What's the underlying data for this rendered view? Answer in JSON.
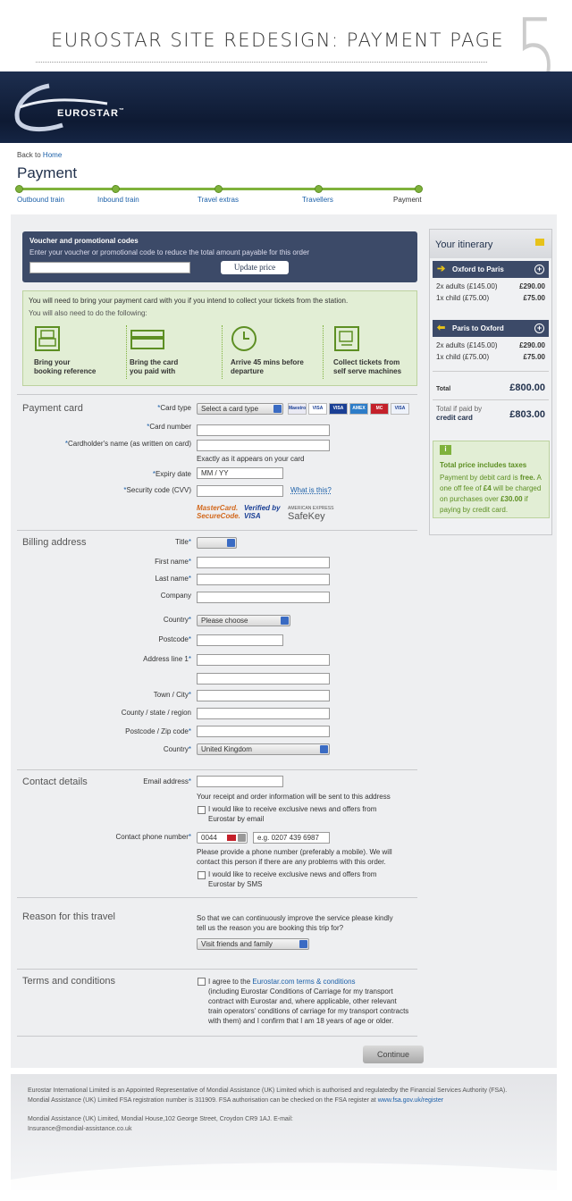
{
  "presentation": {
    "title": "EUROSTAR SITE REDESIGN: PAYMENT PAGE",
    "number": "5"
  },
  "brand": {
    "name": "EUROSTAR",
    "tm": "™"
  },
  "nav": {
    "back": "Back to",
    "home": "Home",
    "page_title": "Payment"
  },
  "progress": [
    {
      "label": "Outbound train"
    },
    {
      "label": "Inbound train"
    },
    {
      "label": "Travel extras"
    },
    {
      "label": "Travellers"
    },
    {
      "label": "Payment"
    }
  ],
  "voucher": {
    "heading": "Voucher and promotional codes",
    "sub": "Enter your voucher or promotional code to reduce the total amount payable for this order",
    "button": "Update price"
  },
  "notice": {
    "line1": "You will need to bring your payment card with you if you intend to collect your tickets from the station.",
    "line2": "You will also need to do the following:",
    "steps": [
      {
        "l1": "Bring your",
        "l2": "booking reference"
      },
      {
        "l1": "Bring the card",
        "l2": "you paid with"
      },
      {
        "l1": "Arrive 45 mins before",
        "l2": "departure"
      },
      {
        "l1": "Collect tickets from",
        "l2": "self serve machines"
      }
    ]
  },
  "payment": {
    "heading": "Payment card",
    "card_type": "Card type",
    "card_type_value": "Select a card type",
    "card_number": "Card number",
    "cardholder": "Cardholder's name (as written on card)",
    "exact": "Exactly as it appears on your card",
    "expiry": "Expiry date",
    "expiry_value": "MM / YY",
    "cvv": "Security code (CVV)",
    "whatis": "What is this?",
    "mc1": "MasterCard.",
    "mc2": "SecureCode.",
    "vv1": "Verified by",
    "vv2": "VISA",
    "ae1": "AMERICAN EXPRESS",
    "ae2": "SafeKey"
  },
  "cards": [
    {
      "name": "Maestro",
      "bg": "#eaeaf4"
    },
    {
      "name": "VISA",
      "bg": "#ffffff"
    },
    {
      "name": "VISA",
      "bg": "#1a3f95"
    },
    {
      "name": "AMEX",
      "bg": "#2c7cc8"
    },
    {
      "name": "MC",
      "bg": "#c4202a"
    },
    {
      "name": "VISA",
      "bg": "#eef2fa"
    }
  ],
  "billing": {
    "heading": "Billing address",
    "title": "Title",
    "first": "First name",
    "last": "Last name",
    "company": "Company",
    "country": "Country",
    "country_value": "Please choose",
    "postcode": "Postcode",
    "addr1": "Address line 1",
    "town": "Town / City",
    "county": "County / state / region",
    "postzip": "Postcode / Zip code",
    "country2": "Country",
    "country2_value": "United Kingdom"
  },
  "contact": {
    "heading": "Contact details",
    "email": "Email address",
    "email_note": "Your receipt and order information will be sent to this address",
    "news1": "I would like to receive exclusive news and offers from",
    "news2": "Eurostar by email",
    "phone": "Contact phone number",
    "code": "0044",
    "phone_ph": "e.g. 0207 439 6987",
    "pnote1": "Please provide a phone number (preferably a mobile). We will",
    "pnote2": "contact this person if there are any problems with this order.",
    "sms1": "I would like to receive exclusive news and offers from",
    "sms2": "Eurostar by SMS"
  },
  "reason": {
    "heading": "Reason for this travel",
    "t1": "So that we can continuously improve the service please kindly",
    "t2": "tell us the reason you are booking this trip for?",
    "value": "Visit friends and family"
  },
  "terms": {
    "heading": "Terms and conditions",
    "a": "I agree to the",
    "link": "Eurostar.com terms & conditions",
    "l2": "(including Eurostar Conditions of Carriage for my transport",
    "l3": "contract with Eurostar and, where applicable, other relevant",
    "l4": "train operators' conditions of carriage for my transport contracts",
    "l5": "with them) and I confirm that I am 18 years of age or older."
  },
  "continue": "Continue",
  "itinerary": {
    "heading": "Your itinerary",
    "out": {
      "route": "Oxford to Paris",
      "a": "2x adults (£145.00)",
      "av": "£290.00",
      "c": "1x child (£75.00)",
      "cv": "£75.00"
    },
    "in": {
      "route": "Paris to Oxford",
      "a": "2x adults (£145.00)",
      "av": "£290.00",
      "c": "1x child (£75.00)",
      "cv": "£75.00"
    },
    "total": "Total",
    "total_v": "£800.00",
    "credit1": "Total if paid by",
    "credit2": "credit card",
    "credit_v": "£803.00",
    "tax_i": "i",
    "tax_t": "Total price includes taxes",
    "tax1": "Payment by debit card is",
    "free": "free.",
    "tax2": "A one off fee of",
    "fee": "£4",
    "tax3": "will be charged on purchases over",
    "over": "£30.00",
    "tax4": "if paying by credit card."
  },
  "footer": {
    "f1": "Eurostar International Limited is an Appointed Representative of Mondial Assistance (UK) Limited which is authorised and regulatedby the Financial Services Authority (FSA).",
    "f2": "Mondial Assistance (UK) Limited FSA registration number is 311909. FSA authorisation can be checked on the FSA register at",
    "f2link": "www.fsa.gov.uk/register",
    "f3": "Mondial Assistance (UK) Limited, Mondial House,102 George Street, Croydon CR9 1AJ. E-mail:",
    "f3link": "Insurance@mondial-assistance.co.uk"
  }
}
